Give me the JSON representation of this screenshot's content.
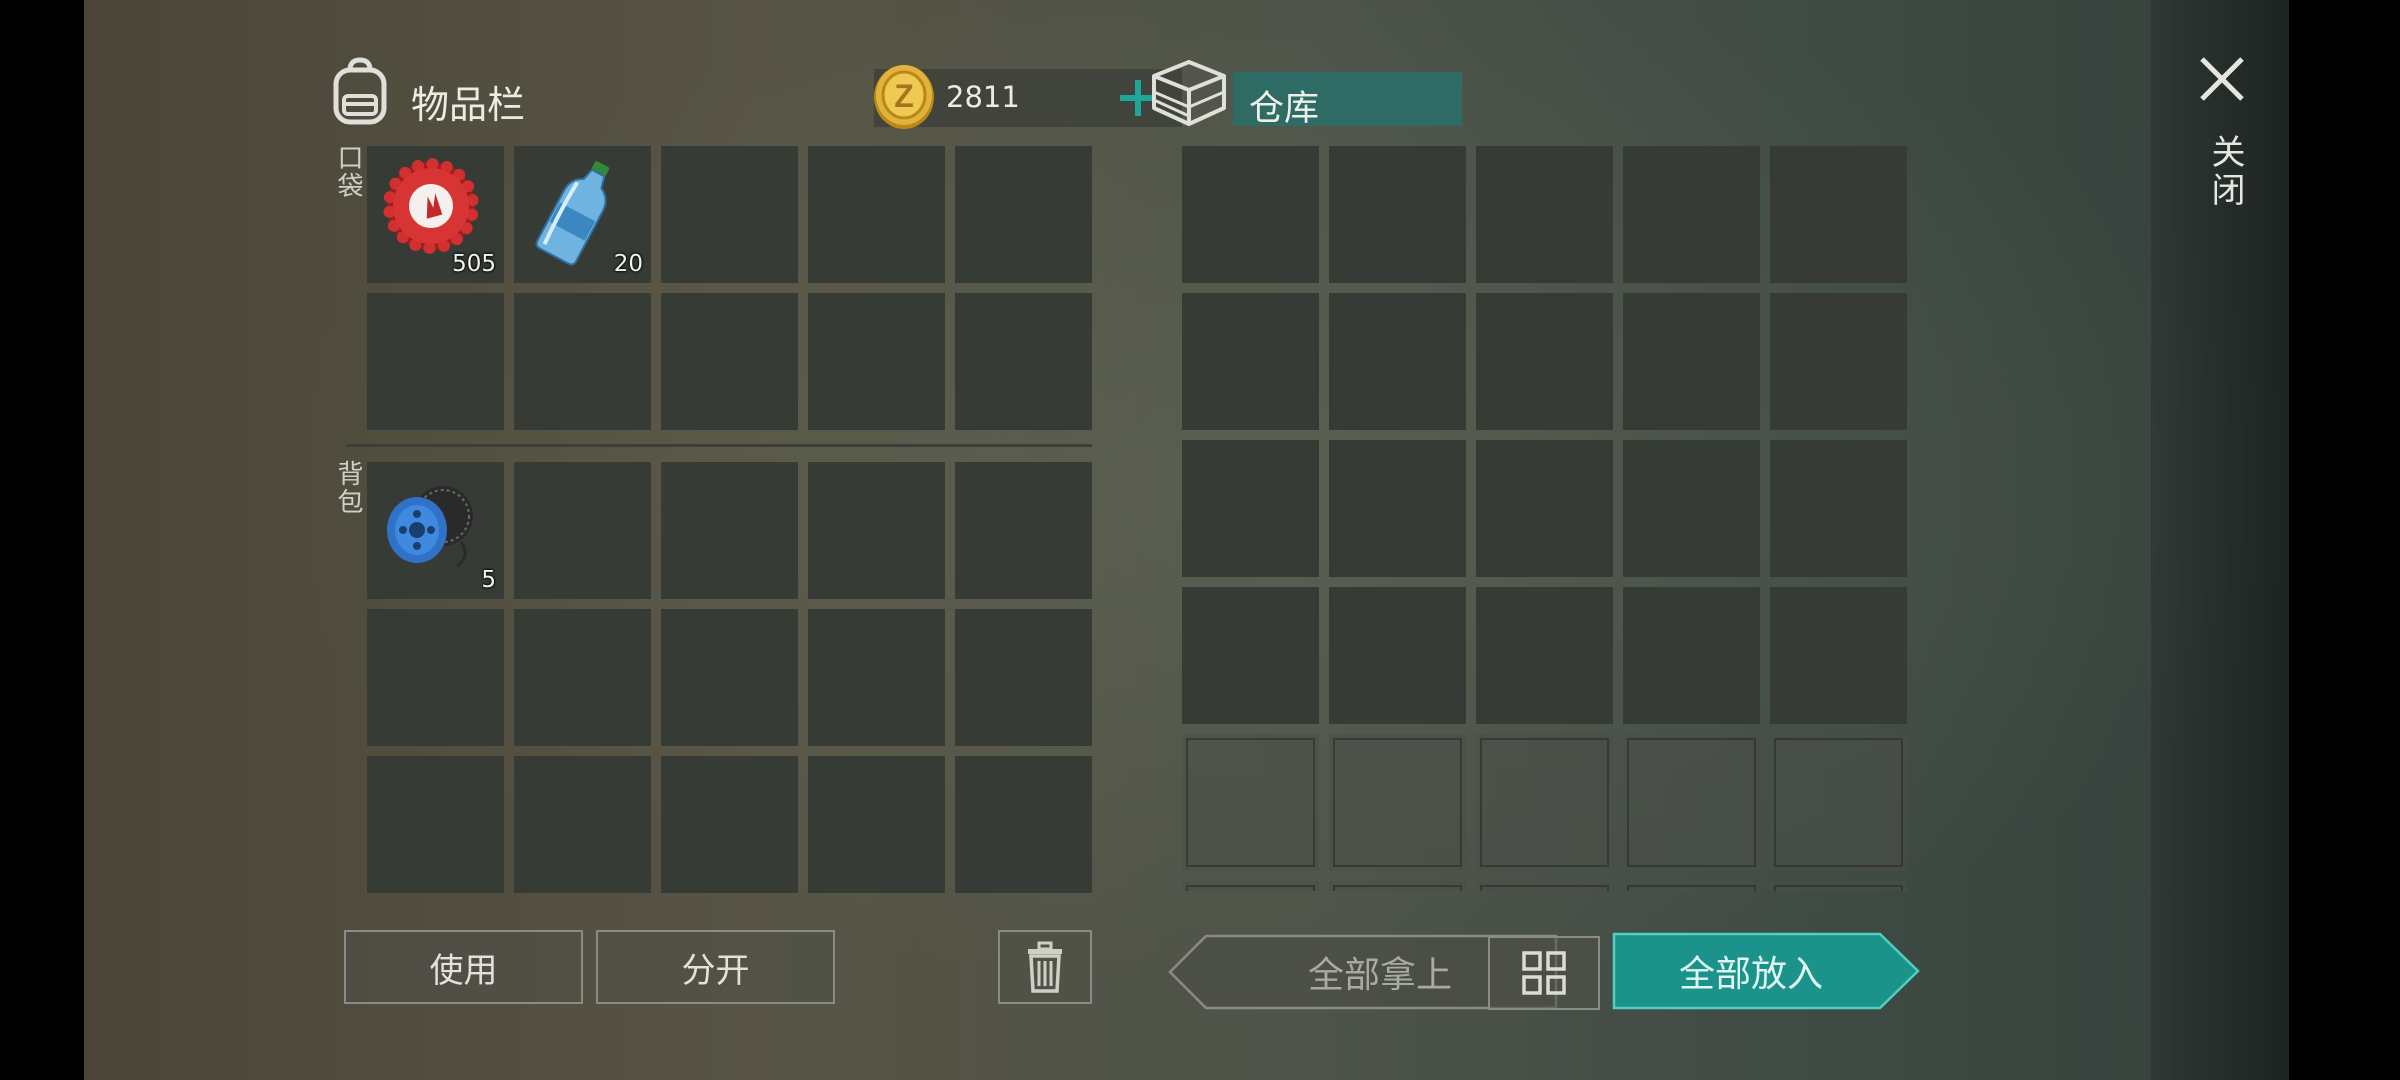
{
  "inventory": {
    "title": "物品栏",
    "pockets_label": "口袋",
    "backpack_label": "背包"
  },
  "currency": {
    "amount": "2811",
    "add_icon": "plus-icon",
    "coin_icon": "gold-coin-icon"
  },
  "pocket_slots": [
    {
      "item": "bottle-cap",
      "count": "505"
    },
    {
      "item": "water-bottle",
      "count": "20"
    },
    {},
    {},
    {},
    {},
    {},
    {},
    {},
    {}
  ],
  "backpack_slots": [
    {
      "item": "wire-spool",
      "count": "5"
    },
    {},
    {},
    {},
    {},
    {},
    {},
    {},
    {},
    {},
    {},
    {},
    {},
    {},
    {}
  ],
  "storage": {
    "title": "仓库",
    "icon": "storage-crate-icon",
    "rows_active": 4,
    "rows_faded": 2,
    "columns": 5
  },
  "buttons": {
    "use": "使用",
    "split": "分开",
    "delete_icon": "trash-icon",
    "take_all": "全部拿上",
    "sort_icon": "grid-sort-icon",
    "put_all": "全部放入"
  },
  "close": {
    "label": "关闭",
    "icon": "close-x-icon"
  },
  "colors": {
    "accent": "#1fa59a",
    "storage_title_bg": "#2e6b64",
    "slot": "#363b36"
  }
}
